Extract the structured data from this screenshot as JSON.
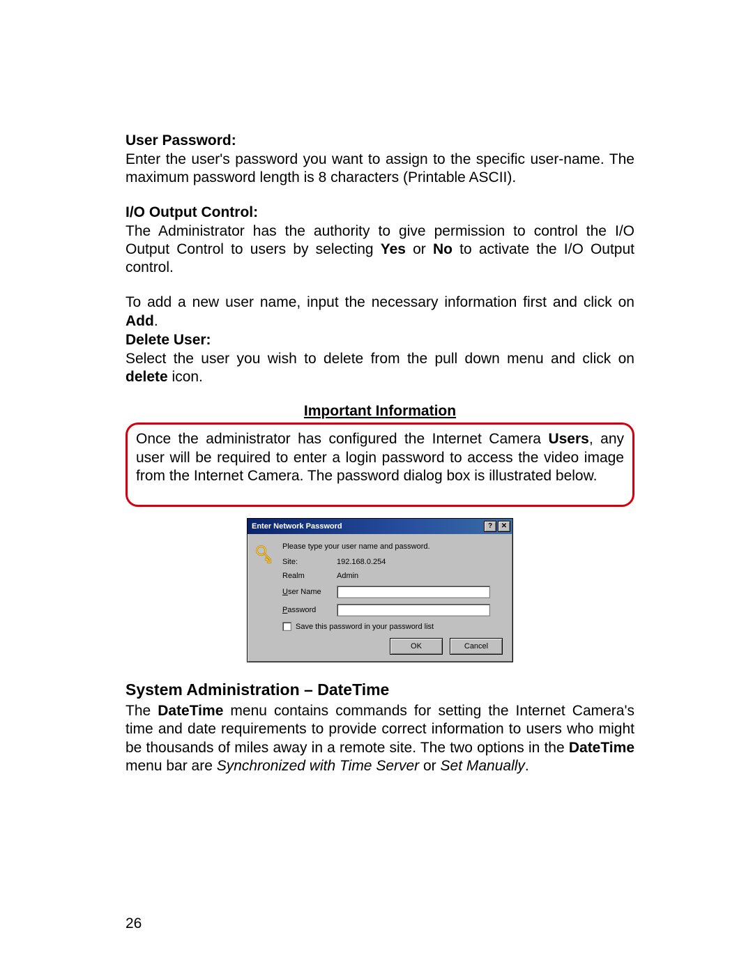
{
  "sections": {
    "userPassword": {
      "heading": "User Password:",
      "body": "Enter the user's password you want to assign to the specific user-name. The maximum password length is 8 characters (Printable ASCII)."
    },
    "ioOutput": {
      "heading": "I/O Output Control:",
      "body_p1_a": "The Administrator has the authority to give permission to control the I/O Output Control to users by selecting ",
      "body_p1_yes": "Yes",
      "body_p1_or": " or ",
      "body_p1_no": "No",
      "body_p1_b": " to activate the I/O Output control.",
      "body_p2_a": "To add a new user name, input the necessary information first and click on ",
      "body_p2_add": "Add",
      "body_p2_b": "."
    },
    "deleteUser": {
      "heading": "Delete User:",
      "body_a": "Select the user you wish to delete from the pull down menu and click on ",
      "body_delete": "delete",
      "body_b": " icon."
    },
    "important": {
      "heading": "Important Information",
      "body_a": "Once the administrator has configured the Internet Camera ",
      "body_users": "Users",
      "body_b": ", any user will be required to enter a login password to access the video image from the Internet Camera. The password dialog box is illustrated below."
    },
    "datetime": {
      "heading": "System Administration – DateTime",
      "body_a": "The ",
      "body_dt1": "DateTime",
      "body_b": " menu contains commands for setting the Internet Camera's time and date requirements to provide correct information to users who might be thousands of miles away in a  remote site. The two options in the ",
      "body_dt2": "DateTime",
      "body_c": " menu bar are ",
      "body_opt1": "Synchronized with Time Server",
      "body_or": " or ",
      "body_opt2": "Set Manually",
      "body_d": "."
    }
  },
  "dialog": {
    "title": "Enter Network Password",
    "help": "?",
    "close": "✕",
    "intro": "Please type your user name and password.",
    "labels": {
      "site": "Site:",
      "realm": "Realm",
      "username_pre": "U",
      "username_rest": "ser Name",
      "password_pre": "P",
      "password_rest": "assword",
      "save_pre": "S",
      "save_rest": "ave this password in your password list"
    },
    "values": {
      "site": "192.168.0.254",
      "realm": "Admin"
    },
    "buttons": {
      "ok": "OK",
      "cancel": "Cancel"
    }
  },
  "pageNumber": "26"
}
